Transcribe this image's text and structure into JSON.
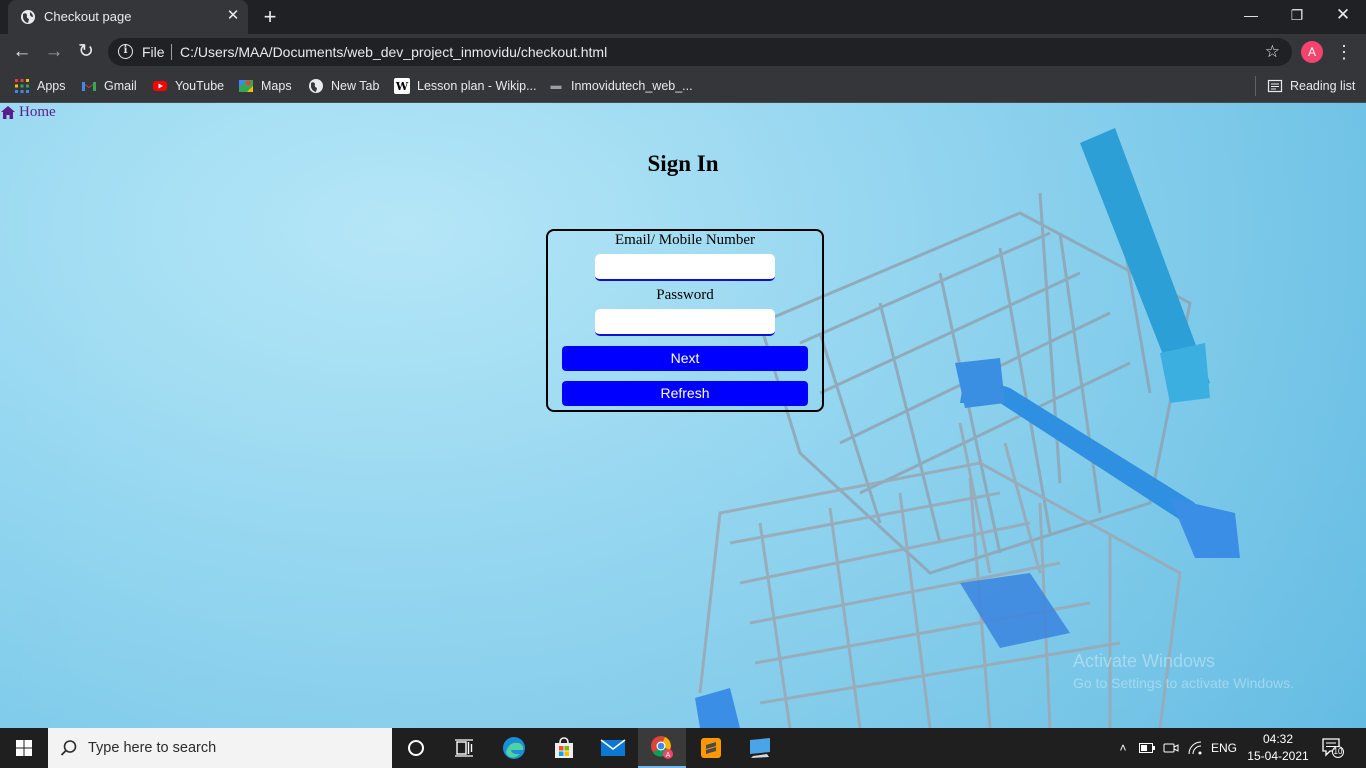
{
  "browser": {
    "tab_title": "Checkout page",
    "new_tab_symbol": "+",
    "address": {
      "scheme": "File",
      "url": "C:/Users/MAA/Documents/web_dev_project_inmovidu/checkout.html"
    },
    "profile_initial": "A",
    "bookmarks": [
      {
        "label": "Apps",
        "icon": "apps-grid-icon"
      },
      {
        "label": "Gmail",
        "icon": "gmail-icon"
      },
      {
        "label": "YouTube",
        "icon": "youtube-icon"
      },
      {
        "label": "Maps",
        "icon": "maps-icon"
      },
      {
        "label": "New Tab",
        "icon": "globe-icon"
      },
      {
        "label": "Lesson plan - Wikip...",
        "icon": "wikipedia-icon"
      },
      {
        "label": "Inmovidutech_web_...",
        "icon": "site-icon"
      }
    ],
    "reading_list": "Reading list"
  },
  "page": {
    "home_link": "Home",
    "title": "Sign In",
    "form": {
      "email_label": "Email/ Mobile Number",
      "email_value": "",
      "password_label": "Password",
      "password_value": "",
      "next_button": "Next",
      "refresh_button": "Refresh"
    },
    "watermark": {
      "line1": "Activate Windows",
      "line2": "Go to Settings to activate Windows."
    }
  },
  "taskbar": {
    "search_placeholder": "Type here to search",
    "language": "ENG",
    "time": "04:32",
    "date": "15-04-2021",
    "notification_count": "10",
    "pinned_apps": [
      "cortana-icon",
      "task-view-icon",
      "edge-icon",
      "store-icon",
      "mail-icon",
      "chrome-icon",
      "sublime-text-icon",
      "desktop-app-icon"
    ]
  },
  "colors": {
    "button_blue": "#0000ff",
    "browser_dark": "#35363a",
    "page_bg": "#93d6f0",
    "home_link": "#5a1e8a"
  }
}
